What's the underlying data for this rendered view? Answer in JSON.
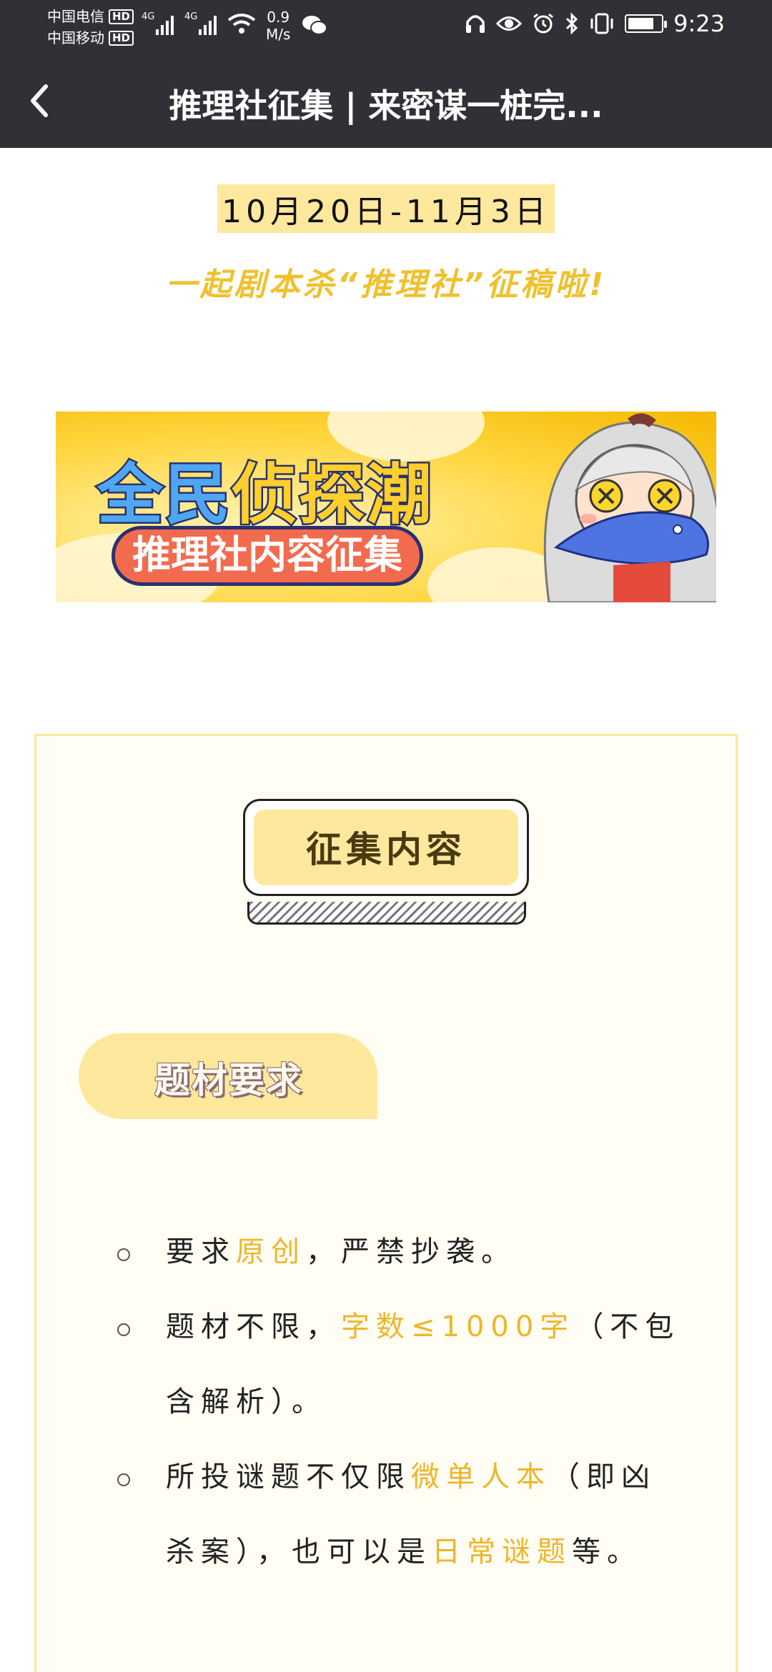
{
  "status_bar": {
    "carrier1": "中国电信",
    "carrier2": "中国移动",
    "hd": "HD",
    "net1": "4G",
    "net2": "4G",
    "speed_value": "0.9",
    "speed_unit": "M/s",
    "time": "9:23",
    "battery_level": 0.8,
    "icons": [
      "wifi-icon",
      "wechat-icon",
      "headphones-icon",
      "eye-icon",
      "alarm-icon",
      "bluetooth-icon",
      "vibrate-icon",
      "battery-icon"
    ]
  },
  "header": {
    "title": "推理社征集 | 来密谋一桩完..."
  },
  "content": {
    "date_range": "10月20日-11月3日",
    "headline": "一起剧本杀“推理社”征稿啦!",
    "banner": {
      "title_part1": "全民",
      "title_part2": "侦探潮",
      "subtitle": "推理社内容征集"
    },
    "collect_button": "征集内容",
    "section_tag": "题材要求",
    "requirements": [
      {
        "p1": "要求",
        "h1": "原创",
        "p2": "，严禁抄袭。"
      },
      {
        "p1": "题材不限，",
        "h1": "字数≤1000字",
        "p2": "（不包含解析）。"
      },
      {
        "p1": "所投谜题不仅限",
        "h1": "微单人本",
        "p2": "（即凶杀案），也可以是",
        "h2": "日常谜题",
        "p3": "等。"
      }
    ]
  },
  "colors": {
    "topbar": "#2f3136",
    "accent_yellow": "#efb52a",
    "pale_yellow": "#fde89d"
  }
}
